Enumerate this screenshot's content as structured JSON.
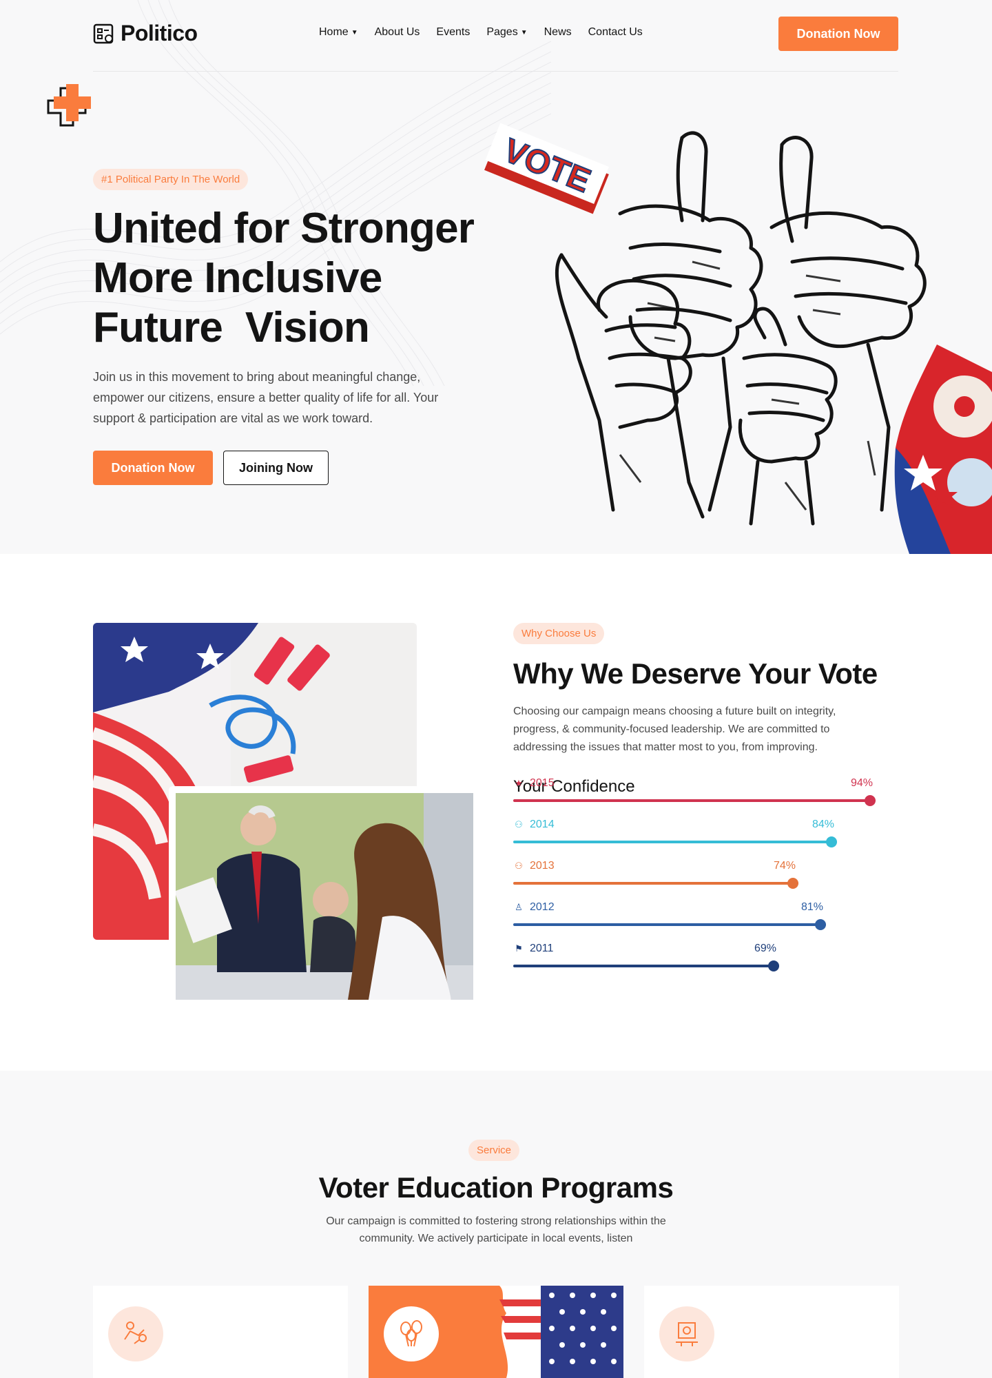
{
  "brand": {
    "name": "Politico"
  },
  "nav": {
    "items": [
      {
        "label": "Home",
        "has_dropdown": true
      },
      {
        "label": "About Us",
        "has_dropdown": false
      },
      {
        "label": "Events",
        "has_dropdown": false
      },
      {
        "label": "Pages",
        "has_dropdown": true
      },
      {
        "label": "News",
        "has_dropdown": false
      },
      {
        "label": "Contact Us",
        "has_dropdown": false
      }
    ],
    "cta_label": "Donation Now"
  },
  "hero": {
    "badge": "#1 Political Party In The World",
    "title_line1": "United for Stronger",
    "title_line2": "More Inclusive",
    "title_line3": "Future  Vision",
    "description": "Join us in this movement to bring about meaningful change, empower our citizens, ensure a better quality of life for all. Your support & participation are vital as we work toward.",
    "primary_button": "Donation Now",
    "secondary_button": "Joining Now",
    "vote_sign": "VOTE"
  },
  "why": {
    "badge": "Why Choose Us",
    "title": "Why We Deserve Your Vote",
    "description": "Choosing our campaign means choosing a future built on integrity, progress, & community-focused leadership. We are committed to addressing the issues that matter most to you, from improving.",
    "confidence_title": "Your Confidence",
    "bars": [
      {
        "year": "2015",
        "percent_label": "94%",
        "value": 94,
        "color": "#d0334f",
        "icon": "star-icon",
        "glyph": "★"
      },
      {
        "year": "2014",
        "percent_label": "84%",
        "value": 84,
        "color": "#35bcd6",
        "icon": "group-icon",
        "glyph": "⚇"
      },
      {
        "year": "2013",
        "percent_label": "74%",
        "value": 74,
        "color": "#e4723a",
        "icon": "users-icon",
        "glyph": "⚇"
      },
      {
        "year": "2012",
        "percent_label": "81%",
        "value": 81,
        "color": "#2d5ea3",
        "icon": "user-icon",
        "glyph": "♙"
      },
      {
        "year": "2011",
        "percent_label": "69%",
        "value": 69,
        "color": "#1f3f7a",
        "icon": "flag-icon",
        "glyph": "⚑"
      }
    ]
  },
  "services": {
    "badge": "Service",
    "title": "Voter Education Programs",
    "description": "Our campaign is committed to fostering strong relationships within the community. We actively participate in local events, listen",
    "cards": [
      {
        "icon": "handshake-icon",
        "highlighted": false
      },
      {
        "icon": "balloons-icon",
        "highlighted": true
      },
      {
        "icon": "presentation-icon",
        "highlighted": false
      }
    ]
  },
  "colors": {
    "accent": "#fa7c3d",
    "accent_light": "#fde6dc",
    "dark": "#141414"
  }
}
